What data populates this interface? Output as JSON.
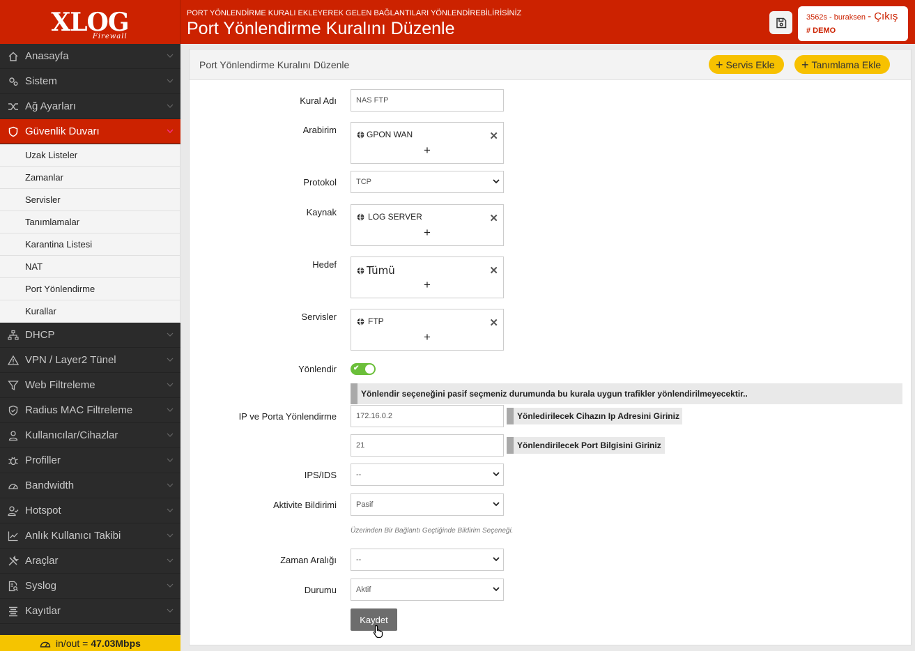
{
  "brand": {
    "logo": "XLOG",
    "logo_sub": "Firewall"
  },
  "header": {
    "subtitle": "PORT YÖNLENDİRME KURALI EKLEYEREK GELEN BAĞLANTILARI YÖNLENDİREBİLİRİSİNİZ",
    "title": "Port Yönlendirme Kuralını Düzenle",
    "user": "3562s - buraksen",
    "logout": "- Çıkış",
    "demo": "# DEMO"
  },
  "sidebar": {
    "items": [
      {
        "label": "Anasayfa",
        "icon": "home-icon"
      },
      {
        "label": "Sistem",
        "icon": "gears-icon"
      },
      {
        "label": "Ağ Ayarları",
        "icon": "shuffle-icon"
      },
      {
        "label": "Güvenlik Duvarı",
        "icon": "shield-icon"
      },
      {
        "label": "DHCP",
        "icon": "sitemap-icon"
      },
      {
        "label": "VPN / Layer2 Tünel",
        "icon": "warning-icon"
      },
      {
        "label": "Web Filtreleme",
        "icon": "filter-icon"
      },
      {
        "label": "Radius MAC Filtreleme",
        "icon": "shield-check-icon"
      },
      {
        "label": "Kullanıcılar/Cihazlar",
        "icon": "user-icon"
      },
      {
        "label": "Profiller",
        "icon": "bug-icon"
      },
      {
        "label": "Bandwidth",
        "icon": "gauge-icon"
      },
      {
        "label": "Hotspot",
        "icon": "user-check-icon"
      },
      {
        "label": "Anlık Kullanıcı Takibi",
        "icon": "chart-line-icon"
      },
      {
        "label": "Araçlar",
        "icon": "tools-icon"
      },
      {
        "label": "Syslog",
        "icon": "file-search-icon"
      },
      {
        "label": "Kayıtlar",
        "icon": "list-icon"
      }
    ],
    "sub_items": [
      "Uzak Listeler",
      "Zamanlar",
      "Servisler",
      "Tanımlamalar",
      "Karantina Listesi",
      "NAT",
      "Port Yönlendirme",
      "Kurallar"
    ],
    "bandwidth_label": "in/out =",
    "bandwidth_value": "47.03Mbps"
  },
  "panel": {
    "title": "Port Yönlendirme Kuralını Düzenle",
    "btn_service": "Servis Ekle",
    "btn_definition": "Tanımlama Ekle"
  },
  "form": {
    "rule_name_label": "Kural Adı",
    "rule_name_value": "NAS FTP",
    "interface_label": "Arabirim",
    "interface_tag": "GPON WAN",
    "protocol_label": "Protokol",
    "protocol_value": "TCP",
    "source_label": "Kaynak",
    "source_tag": "LOG SERVER",
    "target_label": "Hedef",
    "target_tag": "Tümü",
    "services_label": "Servisler",
    "services_tag": "FTP",
    "redirect_label": "Yönlendir",
    "redirect_hint": "Yönlendir seçeneğini pasif seçmeniz durumunda bu kurala uygun trafikler yönlendirilmeyecektir..",
    "ipport_label": "IP ve Porta Yönlendirme",
    "ip_value": "172.16.0.2",
    "ip_hint": "Yönledirilecek Cihazın Ip Adresini Giriniz",
    "port_value": "21",
    "port_hint": "Yönlendirilecek Port Bilgisini Giriniz",
    "ips_label": "IPS/IDS",
    "ips_value": "--",
    "activity_label": "Aktivite Bildirimi",
    "activity_value": "Pasif",
    "activity_note": "Üzerinden Bir Bağlantı Geçtiğinde Bildirim Seçeneği.",
    "time_label": "Zaman Aralığı",
    "time_value": "--",
    "status_label": "Durumu",
    "status_value": "Aktif",
    "save_label": "Kaydet",
    "plus": "+",
    "remove": "✕"
  },
  "colors": {
    "brand_red": "#cc2200",
    "accent_yellow": "#f7c100",
    "sidebar_bg": "#2b2b2b",
    "toggle_green": "#6bbf3a"
  }
}
